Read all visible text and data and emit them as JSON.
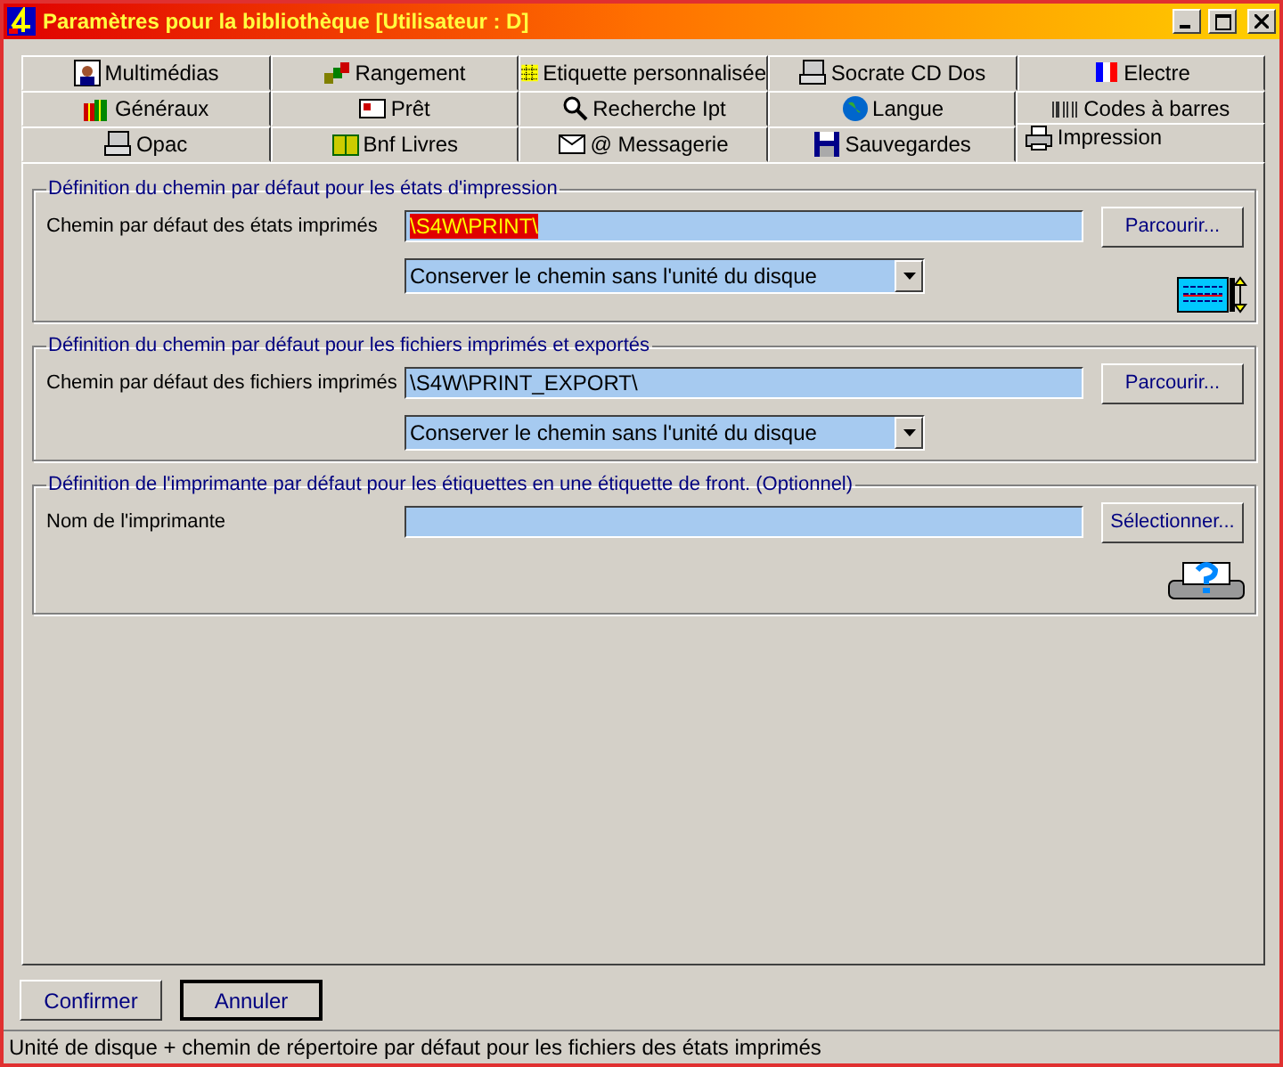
{
  "window": {
    "title": "Paramètres pour la bibliothèque [Utilisateur : D]"
  },
  "tab_rows": [
    {
      "tabs": [
        {
          "label": "Multimédias",
          "selected": false
        },
        {
          "label": "Rangement",
          "selected": false
        },
        {
          "label": "Etiquette personnalisée",
          "selected": false
        },
        {
          "label": "Socrate CD Dos",
          "selected": false
        },
        {
          "label": "Electre",
          "selected": false
        }
      ]
    },
    {
      "tabs": [
        {
          "label": "Généraux",
          "selected": false
        },
        {
          "label": "Prêt",
          "selected": false
        },
        {
          "label": "Recherche Ipt",
          "selected": false
        },
        {
          "label": "Langue",
          "selected": false
        },
        {
          "label": "Codes à barres",
          "selected": false
        }
      ]
    },
    {
      "tabs": [
        {
          "label": "Opac",
          "selected": false
        },
        {
          "label": "Bnf Livres",
          "selected": false
        },
        {
          "label": "@ Messagerie",
          "selected": false
        },
        {
          "label": "Sauvegardes",
          "selected": false
        },
        {
          "label": "Impression",
          "selected": true
        }
      ]
    }
  ],
  "groups": [
    {
      "title": "Définition du chemin par défaut pour les états d'impression",
      "rows": [
        {
          "kind": "path",
          "label": "Chemin par défaut des états imprimés",
          "value": "\\S4W\\PRINT\\",
          "highlighted": true,
          "button": "Parcourir..."
        },
        {
          "kind": "dropdown",
          "value": "Conserver le chemin sans l'unité du disque"
        }
      ]
    },
    {
      "title": "Définition du chemin par défaut pour les fichiers imprimés et exportés",
      "rows": [
        {
          "kind": "path",
          "label": "Chemin par défaut des fichiers imprimés",
          "value": "\\S4W\\PRINT_EXPORT\\",
          "highlighted": false,
          "button": "Parcourir..."
        },
        {
          "kind": "dropdown",
          "value": "Conserver le chemin sans l'unité du disque"
        }
      ]
    },
    {
      "title": "Définition de l'imprimante par défaut pour les étiquettes en une étiquette de front. (Optionnel)",
      "rows": [
        {
          "kind": "path",
          "label": "Nom de l'imprimante",
          "value": "",
          "button": "Sélectionner..."
        }
      ]
    }
  ],
  "buttons": [
    {
      "label": "Confirmer",
      "default": false
    },
    {
      "label": "Annuler",
      "default": true
    }
  ],
  "status_bar": "Unité de disque + chemin de répertoire par défaut pour les fichiers des états imprimés"
}
